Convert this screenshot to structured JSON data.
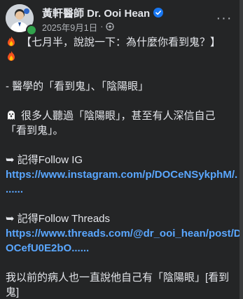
{
  "header": {
    "author": "黃軒醫師 Dr. Ooi Hean",
    "date": "2025年9月1日",
    "separator": "·",
    "more_label": "···"
  },
  "post": {
    "lines": [
      "【七月半，說說一下：為什麼你看到鬼？】",
      "",
      "- 醫學的「看到鬼」、「陰陽眼」",
      "很多人聽過「陰陽眼」，甚至有人深信自己",
      "「看到鬼」。",
      "➥ 記得Follow IG",
      "https://www.instagram.com/p/DOCeNSykphM/.",
      "......",
      "➥ 記得Follow Threads",
      "https://www.threads.com/@dr_ooi_hean/post/D",
      "OCefU0E2bO......",
      "我以前的病人也一直說他自己有「陰陽眼」[看到",
      "鬼]"
    ]
  },
  "colors": {
    "background": "#242526",
    "text": "#e4e6eb",
    "secondary": "#b0b3b8",
    "link": "#5aa7ff",
    "verified": "#1877f2",
    "online": "#31a24c"
  },
  "icons": [
    "fire-icon",
    "ghost-icon",
    "verified-badge-icon",
    "globe-icon",
    "more-icon"
  ]
}
